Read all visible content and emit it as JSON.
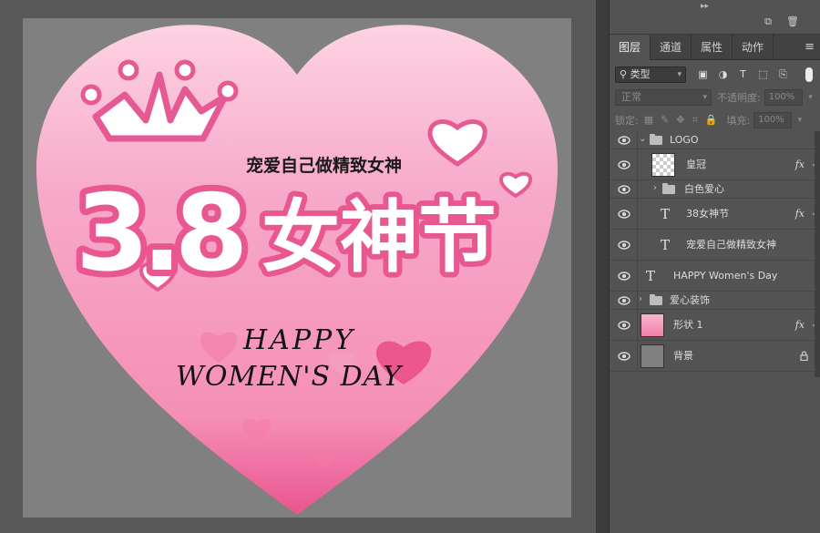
{
  "canvas": {
    "crown_text": "",
    "slogan": "宠爱自己做精致女神",
    "big_number": "3.8",
    "big_title": "女神节",
    "happy_line1": "HAPPY",
    "happy_line2": "WOMEN'S DAY",
    "colors": {
      "heart_top": "#fdd0e1",
      "heart_bottom": "#ec5f98",
      "accent": "#e8578f",
      "white": "#ffffff"
    }
  },
  "panel": {
    "top_icons": [
      "new-layer-icon",
      "trash-icon"
    ],
    "tabs": [
      {
        "label": "图层",
        "active": true
      },
      {
        "label": "通道",
        "active": false
      },
      {
        "label": "属性",
        "active": false
      },
      {
        "label": "动作",
        "active": false
      }
    ],
    "filter": {
      "label": "类型",
      "icons": [
        "image-filter-icon",
        "adjustment-filter-icon",
        "type-filter-icon",
        "shape-filter-icon",
        "smart-object-filter-icon"
      ]
    },
    "blend_mode": "正常",
    "opacity_label": "不透明度:",
    "opacity_value": "100%",
    "lock_label": "锁定:",
    "fill_label": "填充:",
    "fill_value": "100%"
  },
  "layers": [
    {
      "name": "LOGO",
      "kind": "group",
      "expanded": true,
      "fx": false,
      "indent": 0
    },
    {
      "name": "皇冠",
      "kind": "smart",
      "fx": true,
      "indent": 1
    },
    {
      "name": "白色爱心",
      "kind": "group",
      "expanded": false,
      "fx": false,
      "indent": 1
    },
    {
      "name": "38女神节",
      "kind": "text",
      "fx": true,
      "indent": 1
    },
    {
      "name": "宠爱自己做精致女神",
      "kind": "text",
      "fx": false,
      "indent": 1
    },
    {
      "name": "HAPPY Women's Day",
      "kind": "text",
      "fx": false,
      "indent": 0
    },
    {
      "name": "爱心装饰",
      "kind": "group",
      "expanded": false,
      "fx": false,
      "indent": 0
    },
    {
      "name": "形状 1",
      "kind": "shape",
      "fx": true,
      "indent": 0
    },
    {
      "name": "背景",
      "kind": "background",
      "fx": false,
      "locked": true,
      "indent": 0
    }
  ]
}
